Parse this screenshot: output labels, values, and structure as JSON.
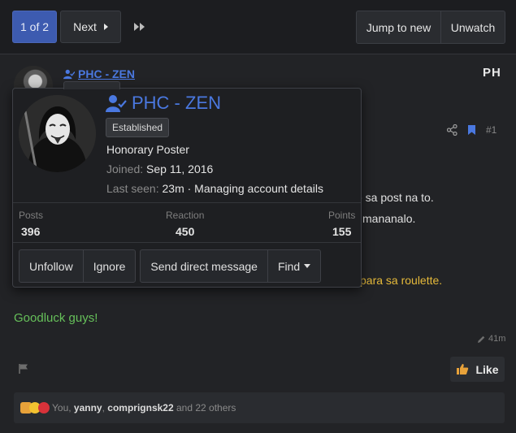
{
  "pagination": {
    "current": "1 of 2",
    "next": "Next"
  },
  "thread_actions": {
    "jump_to_new": "Jump to new",
    "unwatch": "Unwatch"
  },
  "post": {
    "username": "PHC - ZEN",
    "location_tag": "PH",
    "post_number": "#1",
    "body_fragments": [
      "e sa post na to.",
      "mananalo.",
      "para sa roulette."
    ],
    "closing": "Goodluck guys!",
    "edited_ago": "41m",
    "like_label": "Like",
    "reactions": {
      "you": "You",
      "user1": "yanny",
      "user2": "comprignsk22",
      "others": "and 22 others"
    }
  },
  "member_card": {
    "name": "PHC - ZEN",
    "badge": "Established",
    "title": "Honorary Poster",
    "joined_label": "Joined:",
    "joined_value": "Sep 11, 2016",
    "last_seen_label": "Last seen:",
    "last_seen_value": "23m · Managing account details",
    "stats": [
      {
        "label": "Posts",
        "value": "396"
      },
      {
        "label": "Reaction",
        "value": "450"
      },
      {
        "label": "Points",
        "value": "155"
      }
    ],
    "buttons": {
      "unfollow": "Unfollow",
      "ignore": "Ignore",
      "message": "Send direct message",
      "find": "Find"
    }
  },
  "colors": {
    "accent_blue": "#4a78e0",
    "pagination_active": "#3d5bb0",
    "highlight_yellow": "#e5b93a",
    "goodluck_green": "#66c05a"
  }
}
